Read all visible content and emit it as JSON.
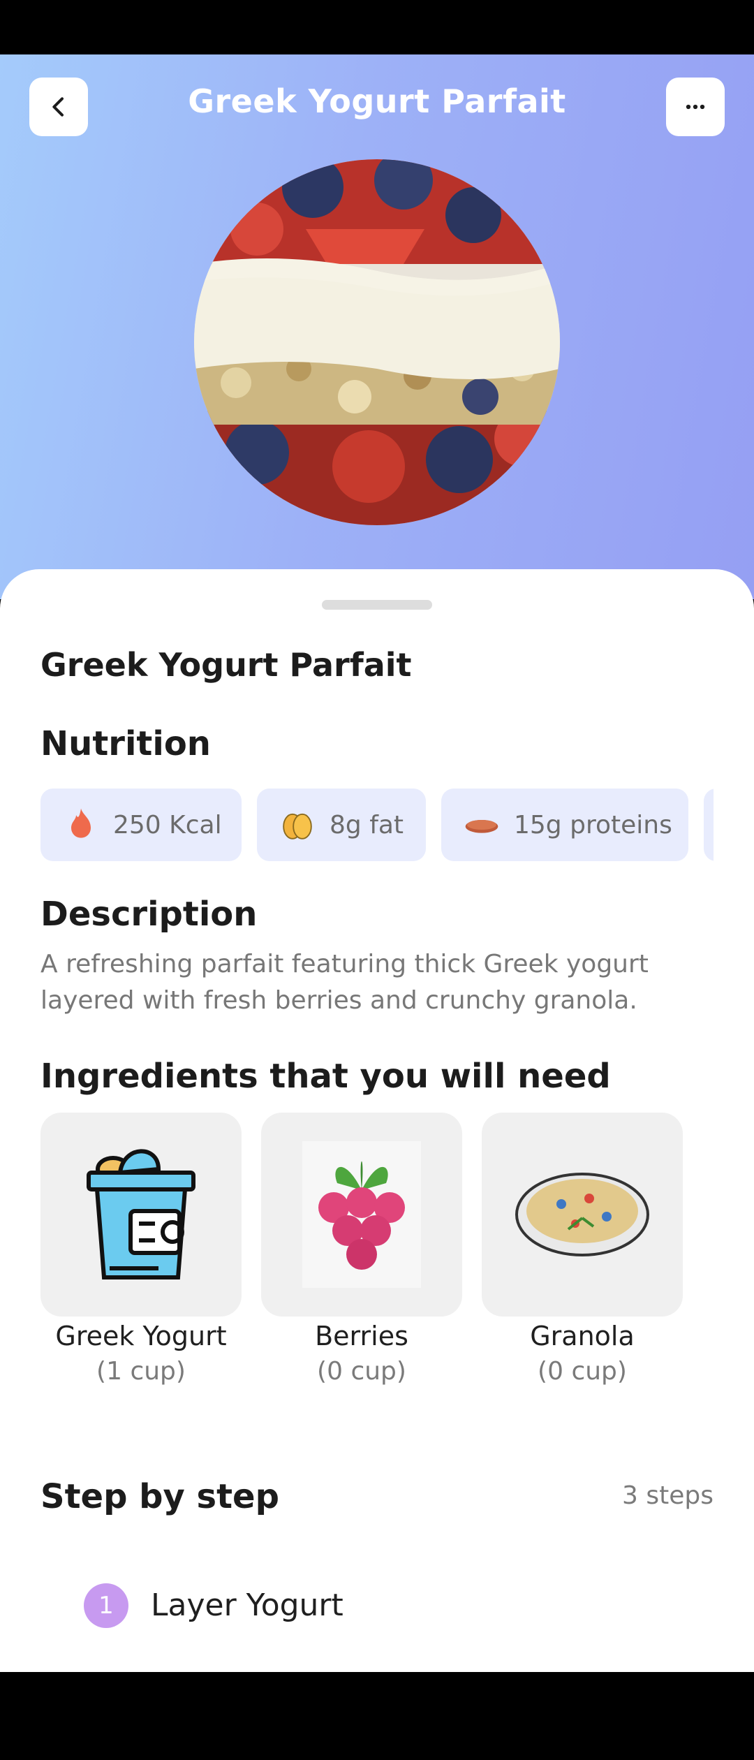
{
  "header": {
    "title": "Greek Yogurt Parfait",
    "back_icon": "chevron-left-icon",
    "more_icon": "more-horizontal-icon"
  },
  "recipe": {
    "name": "Greek Yogurt Parfait",
    "image": "parfait-photo"
  },
  "nutrition": {
    "heading": "Nutrition",
    "items": [
      {
        "label": "250 Kcal",
        "icon": "flame-icon"
      },
      {
        "label": "8g fat",
        "icon": "avocado-icon"
      },
      {
        "label": "15g proteins",
        "icon": "meat-icon"
      }
    ]
  },
  "description": {
    "heading": "Description",
    "text": "A refreshing parfait featuring thick Greek yogurt layered with fresh berries and crunchy granola."
  },
  "ingredients": {
    "heading": "Ingredients that you will need",
    "items": [
      {
        "name": "Greek Yogurt",
        "quantity": "(1 cup)",
        "icon": "yogurt-cup-icon"
      },
      {
        "name": "Berries",
        "quantity": "(0 cup)",
        "icon": "raspberry-icon"
      },
      {
        "name": "Granola",
        "quantity": "(0 cup)",
        "icon": "granola-bowl-icon"
      }
    ]
  },
  "steps": {
    "heading": "Step by step",
    "count_label": "3 steps",
    "items": [
      {
        "number": "1",
        "title": "Layer Yogurt"
      }
    ]
  },
  "colors": {
    "hero_gradient_start": "#a4cbfb",
    "hero_gradient_end": "#959ff3",
    "chip_bg": "#e8ecfd",
    "step_badge": "#c79af0"
  }
}
